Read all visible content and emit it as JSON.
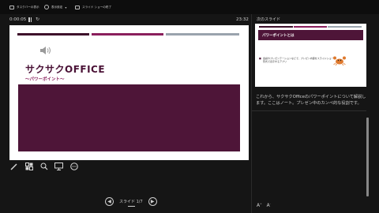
{
  "toolbar": {
    "items": [
      {
        "label": "タスクバーの表示",
        "icon": "taskbar-icon"
      },
      {
        "label": "表示設定",
        "icon": "display-settings-icon"
      },
      {
        "label": "スライド ショーの終了",
        "icon": "end-show-icon"
      }
    ]
  },
  "presenter": {
    "timer": "0:00:05",
    "clock": "23:32",
    "next_slide_label": "次のスライド",
    "slide_counter": "スライド 1/7"
  },
  "current_slide": {
    "title": "サクサクOFFICE",
    "subtitle": "～パワーポイント～",
    "colors": {
      "dark": "#4e1538",
      "accent": "#8a1f5c",
      "gray": "#9aa3ad"
    }
  },
  "next_slide": {
    "heading": "パワーポイントとは",
    "bullet": "会議やプレゼンテーションなどで、プレゼン内容をスライドショー形式で表示するアプリ"
  },
  "notes": {
    "text": "これから、サクサクOfficeのパワーポイントについて解説します。ここはノート。プレゼン中のカンペ的な役割です。"
  },
  "tools": [
    "pen-icon",
    "all-slides-icon",
    "zoom-icon",
    "screen-icon",
    "more-options-icon"
  ]
}
